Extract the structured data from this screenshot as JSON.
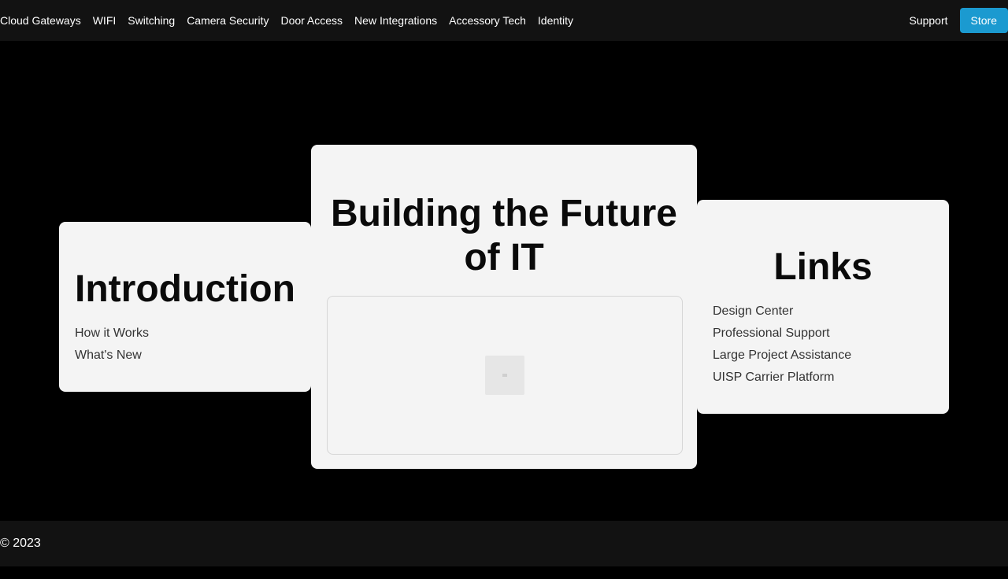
{
  "nav": {
    "items": [
      {
        "label": "Cloud Gateways"
      },
      {
        "label": "WIFI"
      },
      {
        "label": "Switching"
      },
      {
        "label": "Camera Security"
      },
      {
        "label": "Door Access"
      },
      {
        "label": "New Integrations"
      },
      {
        "label": "Accessory Tech"
      },
      {
        "label": "Identity"
      }
    ],
    "support_label": "Support",
    "store_label": "Store"
  },
  "intro": {
    "title": "Introduction",
    "links": [
      "How it Works",
      "What's New"
    ]
  },
  "main": {
    "title": "Building the Future of IT",
    "media_icon": "image-placeholder-icon"
  },
  "links": {
    "title": "Links",
    "items": [
      "Design Center",
      "Professional Support",
      "Large Project Assistance",
      "UISP Carrier Platform"
    ]
  },
  "footer": {
    "copyright": "© 2023"
  },
  "colors": {
    "nav_bg": "#121212",
    "page_bg": "#000000",
    "card_bg": "#f4f4f4",
    "store_accent": "#1b9ad0"
  }
}
